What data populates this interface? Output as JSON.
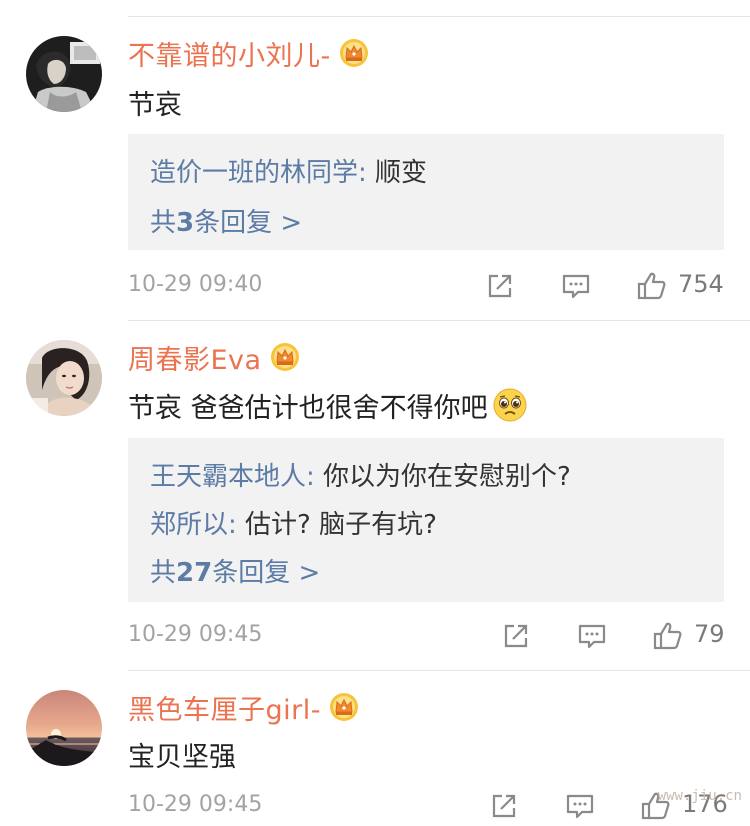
{
  "comments": [
    {
      "username": "不靠谱的小刘儿-",
      "text": "节哀",
      "replies": [
        {
          "user": "造价一班的林同学",
          "sep": ": ",
          "text": "顺变"
        }
      ],
      "more_prefix": "共",
      "more_count": "3",
      "more_suffix": "条回复 >",
      "time": "10-29 09:40",
      "likes": "754"
    },
    {
      "username": "周春影Eva",
      "text": "节哀 爸爸估计也很舍不得你吧",
      "replies": [
        {
          "user": "王天霸本地人",
          "sep": ": ",
          "text": "你以为你在安慰别个?"
        },
        {
          "user": "郑所以",
          "sep": ": ",
          "text": "估计? 脑子有坑?"
        }
      ],
      "more_prefix": "共",
      "more_count": "27",
      "more_suffix": "条回复 >",
      "time": "10-29 09:45",
      "likes": "79"
    },
    {
      "username": "黑色车厘子girl-",
      "text": "宝贝坚强",
      "time": "10-29 09:45",
      "likes": "176"
    }
  ],
  "icons": {
    "badge": "crown-icon",
    "share": "share-icon",
    "comment": "comment-icon",
    "like": "thumbs-up-icon",
    "emoji": "pleading-face-emoji"
  },
  "colors": {
    "username": "#eb7350",
    "reply_user": "#5c7ba5",
    "reply_bg": "#f2f2f2",
    "meta": "#a3a3a3"
  },
  "watermark": "www.jiu.cn"
}
